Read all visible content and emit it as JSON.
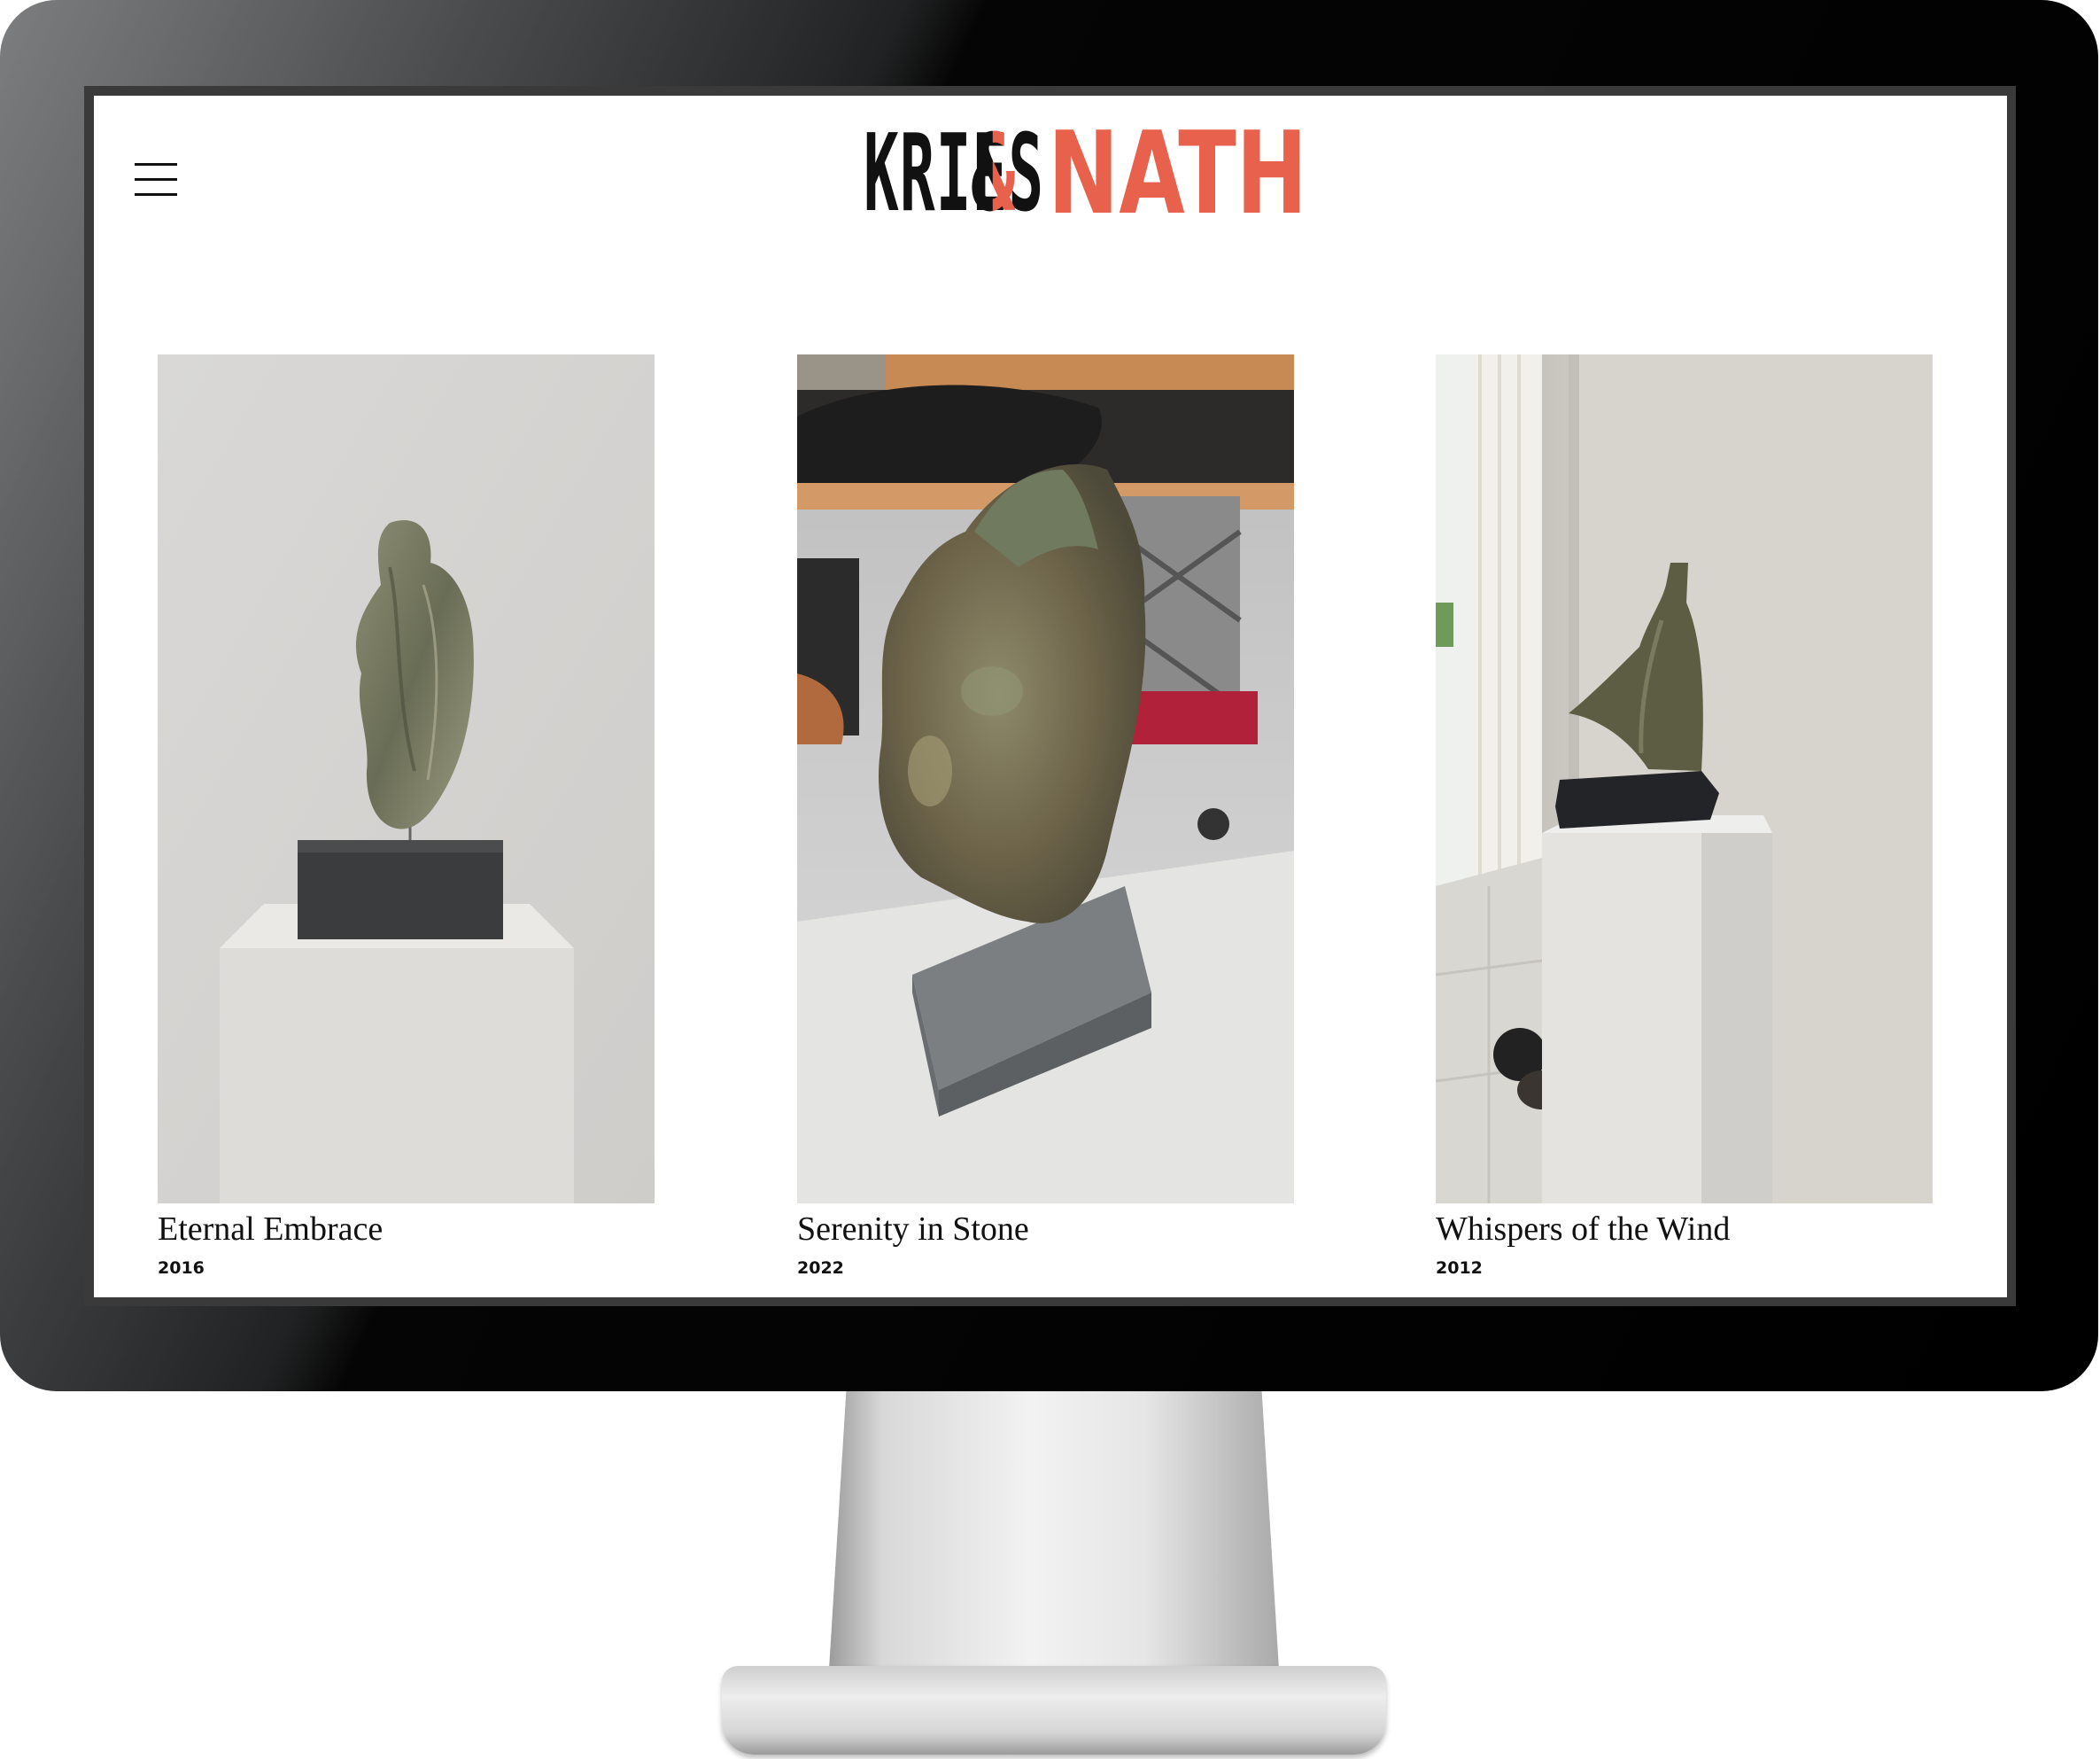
{
  "site": {
    "logo": {
      "word1": "KRIES",
      "ampersand": "&",
      "word2": "NATH"
    },
    "colors": {
      "accent": "#e8614c",
      "text": "#111111",
      "background": "#ffffff"
    },
    "menu_icon": "hamburger-menu-icon"
  },
  "gallery": {
    "items": [
      {
        "title": "Eternal Embrace",
        "year": "2016"
      },
      {
        "title": "Serenity in Stone",
        "year": "2022"
      },
      {
        "title": "Whispers of the Wind",
        "year": "2012"
      }
    ]
  }
}
